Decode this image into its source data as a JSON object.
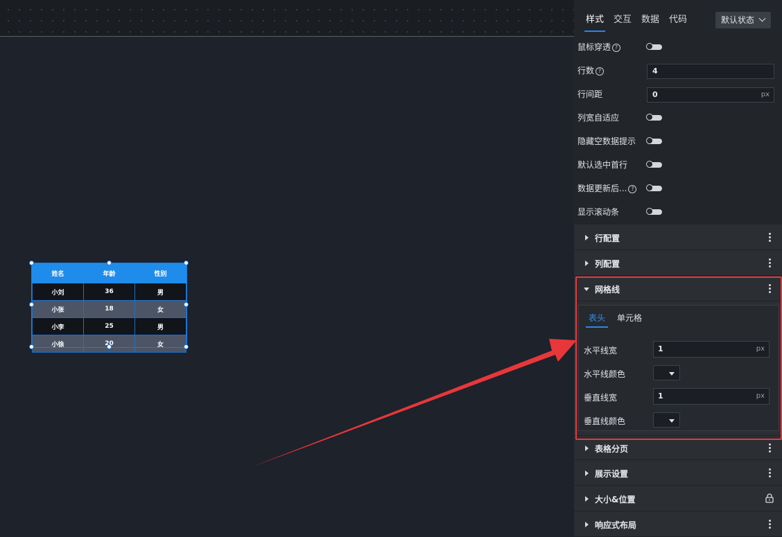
{
  "colors": {
    "accent": "#2b86ea",
    "header_blue": "#1f8ceb",
    "highlight_red": "#e8373a"
  },
  "table_widget": {
    "headers": [
      "姓名",
      "年龄",
      "性别"
    ],
    "rows": [
      [
        "小刘",
        "36",
        "男"
      ],
      [
        "小张",
        "18",
        "女"
      ],
      [
        "小李",
        "25",
        "男"
      ],
      [
        "小徐",
        "20",
        "女"
      ]
    ]
  },
  "panel": {
    "tabs": [
      {
        "label": "样式",
        "active": true
      },
      {
        "label": "交互",
        "active": false
      },
      {
        "label": "数据",
        "active": false
      },
      {
        "label": "代码",
        "active": false
      }
    ],
    "state_select": "默认状态",
    "properties": {
      "mouse_through": "鼠标穿透",
      "row_count": "行数",
      "row_count_value": "4",
      "row_spacing": "行间距",
      "row_spacing_value": "0",
      "row_spacing_unit": "px",
      "col_auto_width": "列宽自适应",
      "hide_empty_tip": "隐藏空数据提示",
      "select_first_row": "默认选中首行",
      "after_data_update": "数据更新后...",
      "show_scrollbar": "显示滚动条"
    },
    "sections": {
      "row_config": "行配置",
      "col_config": "列配置",
      "grid_lines": "网格线",
      "pagination": "表格分页",
      "display": "展示设置",
      "size_position": "大小&位置",
      "responsive": "响应式布局"
    },
    "grid_lines": {
      "tab_header": "表头",
      "tab_cell": "单元格",
      "h_width_label": "水平线宽",
      "h_width_value": "1",
      "h_width_unit": "px",
      "h_color_label": "水平线颜色",
      "v_width_label": "垂直线宽",
      "v_width_value": "1",
      "v_width_unit": "px",
      "v_color_label": "垂直线颜色"
    }
  }
}
